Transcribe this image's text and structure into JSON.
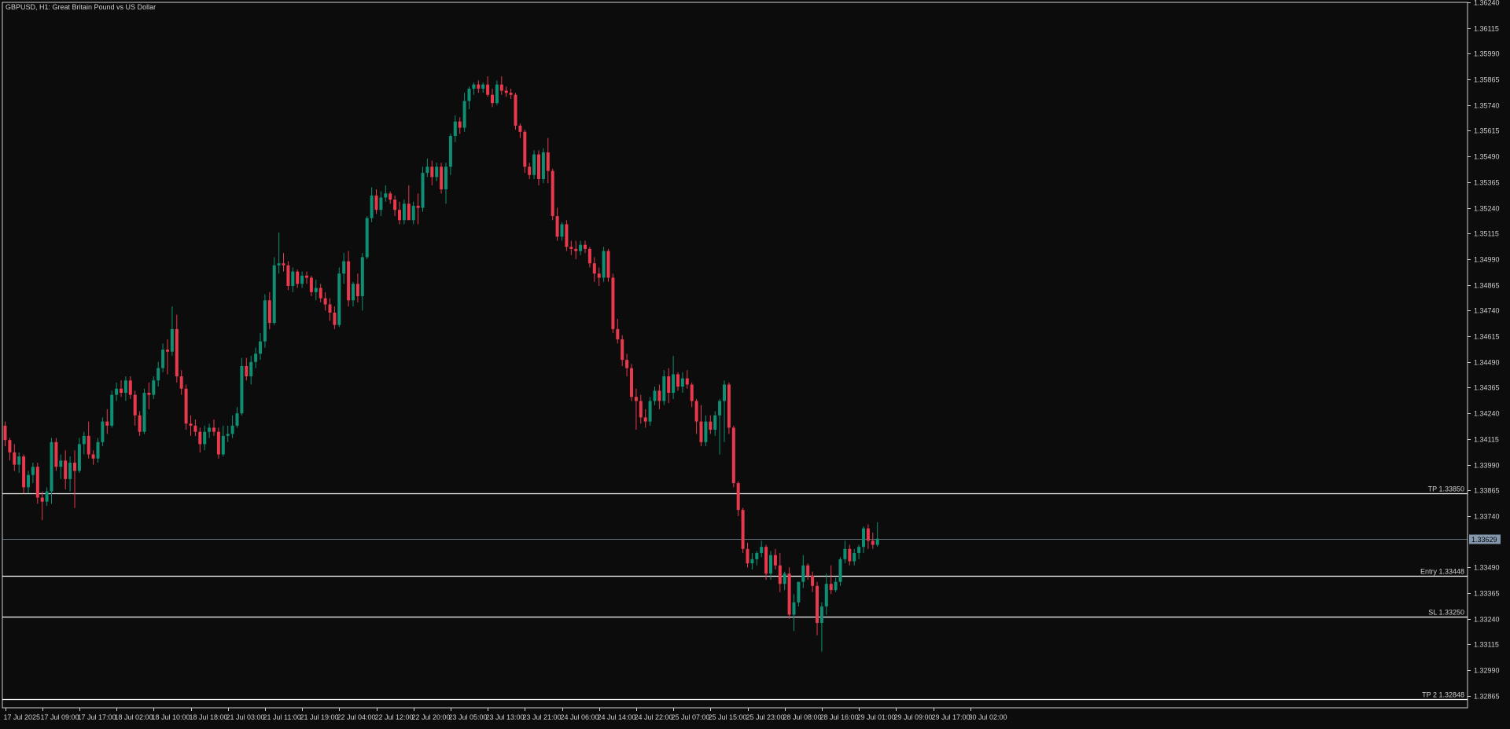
{
  "header": {
    "title": "GBPUSD, H1:  Great Britain Pound vs US Dollar"
  },
  "colors": {
    "background": "#0c0c0c",
    "frame": "#d0d0d0",
    "text": "#d0d0d0",
    "bull": "#0e8f73",
    "bear": "#e8394d",
    "level_line": "#ffffff",
    "bid_line": "#8497ad",
    "bid_tag_bg": "#8497ad",
    "bid_tag_text": "#0c0c0c"
  },
  "chart_data": {
    "type": "candlestick",
    "symbol": "GBPUSD",
    "timeframe": "H1",
    "title": "Great Britain Pound vs US Dollar",
    "ylim": [
      1.32807,
      1.3624
    ],
    "y_ticks": [
      "1.36240",
      "1.36115",
      "1.35990",
      "1.35865",
      "1.35740",
      "1.35615",
      "1.35490",
      "1.35365",
      "1.35240",
      "1.35115",
      "1.34990",
      "1.34865",
      "1.34740",
      "1.34615",
      "1.34490",
      "1.34365",
      "1.34240",
      "1.34115",
      "1.33990",
      "1.33865",
      "1.33740",
      "1.33490",
      "1.33365",
      "1.33240",
      "1.33115",
      "1.32990",
      "1.32865"
    ],
    "x_ticks": [
      {
        "label": "17 Jul 2025",
        "bar": 0
      },
      {
        "label": "17 Jul 09:00",
        "bar": 8
      },
      {
        "label": "17 Jul 17:00",
        "bar": 16
      },
      {
        "label": "18 Jul 02:00",
        "bar": 24
      },
      {
        "label": "18 Jul 10:00",
        "bar": 32
      },
      {
        "label": "18 Jul 18:00",
        "bar": 40
      },
      {
        "label": "21 Jul 03:00",
        "bar": 48
      },
      {
        "label": "21 Jul 11:00",
        "bar": 56
      },
      {
        "label": "21 Jul 19:00",
        "bar": 64
      },
      {
        "label": "22 Jul 04:00",
        "bar": 72
      },
      {
        "label": "22 Jul 12:00",
        "bar": 80
      },
      {
        "label": "22 Jul 20:00",
        "bar": 88
      },
      {
        "label": "23 Jul 05:00",
        "bar": 96
      },
      {
        "label": "23 Jul 13:00",
        "bar": 104
      },
      {
        "label": "23 Jul 21:00",
        "bar": 112
      },
      {
        "label": "24 Jul 06:00",
        "bar": 120
      },
      {
        "label": "24 Jul 14:00",
        "bar": 128
      },
      {
        "label": "24 Jul 22:00",
        "bar": 136
      },
      {
        "label": "25 Jul 07:00",
        "bar": 144
      },
      {
        "label": "25 Jul 15:00",
        "bar": 152
      },
      {
        "label": "25 Jul 23:00",
        "bar": 160
      },
      {
        "label": "28 Jul 08:00",
        "bar": 168
      },
      {
        "label": "28 Jul 16:00",
        "bar": 176
      },
      {
        "label": "29 Jul 01:00",
        "bar": 184
      },
      {
        "label": "29 Jul 09:00",
        "bar": 192
      },
      {
        "label": "29 Jul 17:00",
        "bar": 200
      },
      {
        "label": "30 Jul 02:00",
        "bar": 208
      }
    ],
    "levels": [
      {
        "label": "TP 1.33850",
        "value": 1.3385
      },
      {
        "label": "Entry 1.33448",
        "value": 1.33448
      },
      {
        "label": "SL 1.33250",
        "value": 1.3325
      },
      {
        "label": "TP 2 1.32848",
        "value": 1.32848
      }
    ],
    "current_price": {
      "label": "1.33629",
      "value": 1.33629
    },
    "ohlc": [
      [
        1.3418,
        1.342,
        1.3408,
        1.3411
      ],
      [
        1.3411,
        1.3412,
        1.3401,
        1.3405
      ],
      [
        1.3405,
        1.3409,
        1.3396,
        1.3399
      ],
      [
        1.3399,
        1.3405,
        1.3395,
        1.3403
      ],
      [
        1.3403,
        1.3404,
        1.3385,
        1.3388
      ],
      [
        1.3388,
        1.3396,
        1.3385,
        1.3394
      ],
      [
        1.3394,
        1.34,
        1.339,
        1.3398
      ],
      [
        1.3398,
        1.34,
        1.338,
        1.3383
      ],
      [
        1.3383,
        1.3386,
        1.3372,
        1.3381
      ],
      [
        1.3381,
        1.3388,
        1.3379,
        1.3386
      ],
      [
        1.3386,
        1.3412,
        1.338,
        1.341
      ],
      [
        1.341,
        1.3412,
        1.3396,
        1.3398
      ],
      [
        1.3398,
        1.3404,
        1.3392,
        1.3401
      ],
      [
        1.3401,
        1.3406,
        1.3387,
        1.3392
      ],
      [
        1.3392,
        1.3403,
        1.3386,
        1.34
      ],
      [
        1.34,
        1.3406,
        1.3378,
        1.3396
      ],
      [
        1.3396,
        1.3412,
        1.3395,
        1.3409
      ],
      [
        1.3409,
        1.3415,
        1.3404,
        1.3413
      ],
      [
        1.3413,
        1.342,
        1.3402,
        1.3404
      ],
      [
        1.3404,
        1.3406,
        1.3399,
        1.3402
      ],
      [
        1.3402,
        1.3412,
        1.34,
        1.341
      ],
      [
        1.341,
        1.3422,
        1.3408,
        1.342
      ],
      [
        1.342,
        1.3426,
        1.3414,
        1.3418
      ],
      [
        1.3418,
        1.3435,
        1.3417,
        1.3433
      ],
      [
        1.3433,
        1.3439,
        1.343,
        1.3436
      ],
      [
        1.3436,
        1.344,
        1.3432,
        1.3434
      ],
      [
        1.3434,
        1.3442,
        1.343,
        1.344
      ],
      [
        1.344,
        1.3442,
        1.3431,
        1.3433
      ],
      [
        1.3433,
        1.3435,
        1.3418,
        1.3423
      ],
      [
        1.3423,
        1.3425,
        1.3413,
        1.3415
      ],
      [
        1.3415,
        1.3436,
        1.3414,
        1.3434
      ],
      [
        1.3434,
        1.3439,
        1.3426,
        1.3433
      ],
      [
        1.3433,
        1.3442,
        1.3431,
        1.344
      ],
      [
        1.344,
        1.3449,
        1.3437,
        1.3446
      ],
      [
        1.3446,
        1.3458,
        1.3444,
        1.3455
      ],
      [
        1.3455,
        1.346,
        1.3443,
        1.3454
      ],
      [
        1.3454,
        1.3476,
        1.3452,
        1.3465
      ],
      [
        1.3465,
        1.3472,
        1.3439,
        1.3442
      ],
      [
        1.3442,
        1.3445,
        1.3433,
        1.3436
      ],
      [
        1.3436,
        1.3438,
        1.3416,
        1.3419
      ],
      [
        1.3419,
        1.3423,
        1.3413,
        1.3418
      ],
      [
        1.3418,
        1.3421,
        1.3413,
        1.3415
      ],
      [
        1.3415,
        1.3417,
        1.3405,
        1.3409
      ],
      [
        1.3409,
        1.3418,
        1.3406,
        1.3415
      ],
      [
        1.3415,
        1.3419,
        1.3412,
        1.3417
      ],
      [
        1.3417,
        1.3421,
        1.3413,
        1.3415
      ],
      [
        1.3415,
        1.3417,
        1.3402,
        1.3404
      ],
      [
        1.3404,
        1.3418,
        1.3403,
        1.3413
      ],
      [
        1.3413,
        1.3418,
        1.341,
        1.3414
      ],
      [
        1.3414,
        1.3423,
        1.3412,
        1.3418
      ],
      [
        1.3418,
        1.3427,
        1.3417,
        1.3424
      ],
      [
        1.3424,
        1.3451,
        1.3423,
        1.3447
      ],
      [
        1.3447,
        1.3451,
        1.344,
        1.3442
      ],
      [
        1.3442,
        1.3452,
        1.3438,
        1.3449
      ],
      [
        1.3449,
        1.3456,
        1.3446,
        1.3453
      ],
      [
        1.3453,
        1.3463,
        1.345,
        1.3459
      ],
      [
        1.3459,
        1.3482,
        1.3456,
        1.3479
      ],
      [
        1.3479,
        1.3483,
        1.3465,
        1.3468
      ],
      [
        1.3468,
        1.35,
        1.3467,
        1.3496
      ],
      [
        1.3496,
        1.3512,
        1.3492,
        1.3497
      ],
      [
        1.3497,
        1.3502,
        1.3493,
        1.3496
      ],
      [
        1.3496,
        1.3498,
        1.3484,
        1.3486
      ],
      [
        1.3486,
        1.3495,
        1.3483,
        1.3493
      ],
      [
        1.3493,
        1.3494,
        1.3485,
        1.3487
      ],
      [
        1.3487,
        1.3493,
        1.3485,
        1.3491
      ],
      [
        1.3491,
        1.3493,
        1.3487,
        1.349
      ],
      [
        1.349,
        1.3491,
        1.3481,
        1.3483
      ],
      [
        1.3483,
        1.3489,
        1.3479,
        1.3485
      ],
      [
        1.3485,
        1.3487,
        1.3478,
        1.348
      ],
      [
        1.348,
        1.3483,
        1.3474,
        1.3477
      ],
      [
        1.3477,
        1.348,
        1.3469,
        1.3473
      ],
      [
        1.3473,
        1.3476,
        1.3465,
        1.3467
      ],
      [
        1.3467,
        1.3495,
        1.3466,
        1.3492
      ],
      [
        1.3492,
        1.3502,
        1.3487,
        1.3498
      ],
      [
        1.3498,
        1.3503,
        1.3476,
        1.3479
      ],
      [
        1.3479,
        1.3488,
        1.3476,
        1.3487
      ],
      [
        1.3487,
        1.3492,
        1.3478,
        1.3481
      ],
      [
        1.3481,
        1.3502,
        1.3474,
        1.35
      ],
      [
        1.35,
        1.352,
        1.3499,
        1.3519
      ],
      [
        1.3519,
        1.3534,
        1.3517,
        1.353
      ],
      [
        1.353,
        1.3533,
        1.3521,
        1.3523
      ],
      [
        1.3523,
        1.3532,
        1.352,
        1.3529
      ],
      [
        1.3529,
        1.3535,
        1.3527,
        1.3531
      ],
      [
        1.3531,
        1.3532,
        1.3526,
        1.3528
      ],
      [
        1.3528,
        1.353,
        1.352,
        1.3523
      ],
      [
        1.3523,
        1.3527,
        1.3516,
        1.3518
      ],
      [
        1.3518,
        1.3528,
        1.3516,
        1.3526
      ],
      [
        1.3526,
        1.3535,
        1.3522,
        1.3518
      ],
      [
        1.3518,
        1.3527,
        1.3516,
        1.3525
      ],
      [
        1.3525,
        1.3531,
        1.3516,
        1.3524
      ],
      [
        1.3524,
        1.3544,
        1.3522,
        1.3541
      ],
      [
        1.3541,
        1.3548,
        1.3539,
        1.3544
      ],
      [
        1.3544,
        1.3547,
        1.3535,
        1.3539
      ],
      [
        1.3539,
        1.3546,
        1.3537,
        1.3544
      ],
      [
        1.3544,
        1.3546,
        1.3531,
        1.3533
      ],
      [
        1.3533,
        1.3546,
        1.3526,
        1.3544
      ],
      [
        1.3544,
        1.356,
        1.354,
        1.3559
      ],
      [
        1.3559,
        1.3569,
        1.3556,
        1.3566
      ],
      [
        1.3566,
        1.3568,
        1.356,
        1.3563
      ],
      [
        1.3563,
        1.358,
        1.3561,
        1.3576
      ],
      [
        1.3576,
        1.3583,
        1.3572,
        1.3582
      ],
      [
        1.3582,
        1.3585,
        1.3579,
        1.3584
      ],
      [
        1.3584,
        1.3586,
        1.358,
        1.3582
      ],
      [
        1.3582,
        1.3585,
        1.358,
        1.3584
      ],
      [
        1.3584,
        1.3588,
        1.3578,
        1.3579
      ],
      [
        1.3579,
        1.3582,
        1.3573,
        1.3575
      ],
      [
        1.3575,
        1.3586,
        1.3574,
        1.3584
      ],
      [
        1.3584,
        1.3588,
        1.3579,
        1.3581
      ],
      [
        1.3581,
        1.3583,
        1.3578,
        1.358
      ],
      [
        1.358,
        1.3582,
        1.3577,
        1.3579
      ],
      [
        1.3579,
        1.358,
        1.3562,
        1.3564
      ],
      [
        1.3564,
        1.3565,
        1.3558,
        1.3561
      ],
      [
        1.3561,
        1.3562,
        1.3541,
        1.3544
      ],
      [
        1.3544,
        1.3546,
        1.3538,
        1.354
      ],
      [
        1.354,
        1.3552,
        1.3538,
        1.355
      ],
      [
        1.355,
        1.3552,
        1.3535,
        1.3538
      ],
      [
        1.3538,
        1.3553,
        1.3536,
        1.3551
      ],
      [
        1.3551,
        1.3558,
        1.3536,
        1.3542
      ],
      [
        1.3542,
        1.3543,
        1.3518,
        1.352
      ],
      [
        1.352,
        1.3524,
        1.3508,
        1.351
      ],
      [
        1.351,
        1.3517,
        1.3508,
        1.3516
      ],
      [
        1.3516,
        1.3518,
        1.3503,
        1.3505
      ],
      [
        1.3505,
        1.3508,
        1.3501,
        1.3504
      ],
      [
        1.3504,
        1.3508,
        1.3499,
        1.3503
      ],
      [
        1.3503,
        1.3508,
        1.3501,
        1.3506
      ],
      [
        1.3506,
        1.3508,
        1.3502,
        1.3504
      ],
      [
        1.3504,
        1.3505,
        1.3495,
        1.3497
      ],
      [
        1.3497,
        1.35,
        1.3488,
        1.3492
      ],
      [
        1.3492,
        1.3495,
        1.3486,
        1.349
      ],
      [
        1.349,
        1.3505,
        1.3488,
        1.3503
      ],
      [
        1.3503,
        1.3504,
        1.3488,
        1.349
      ],
      [
        1.349,
        1.3492,
        1.3463,
        1.3465
      ],
      [
        1.3465,
        1.347,
        1.3458,
        1.346
      ],
      [
        1.346,
        1.3462,
        1.3447,
        1.345
      ],
      [
        1.345,
        1.3453,
        1.3442,
        1.3446
      ],
      [
        1.3446,
        1.3448,
        1.343,
        1.3432
      ],
      [
        1.3432,
        1.3436,
        1.3416,
        1.343
      ],
      [
        1.343,
        1.3433,
        1.3419,
        1.3422
      ],
      [
        1.3422,
        1.3426,
        1.3417,
        1.342
      ],
      [
        1.342,
        1.3432,
        1.3418,
        1.343
      ],
      [
        1.343,
        1.3437,
        1.3428,
        1.3435
      ],
      [
        1.3435,
        1.3438,
        1.3426,
        1.343
      ],
      [
        1.343,
        1.3445,
        1.3428,
        1.3442
      ],
      [
        1.3442,
        1.3446,
        1.3429,
        1.3434
      ],
      [
        1.3434,
        1.3452,
        1.3431,
        1.3443
      ],
      [
        1.3443,
        1.3444,
        1.3435,
        1.3437
      ],
      [
        1.3437,
        1.3444,
        1.3434,
        1.3441
      ],
      [
        1.3441,
        1.3445,
        1.3436,
        1.3438
      ],
      [
        1.3438,
        1.3439,
        1.3427,
        1.343
      ],
      [
        1.343,
        1.3431,
        1.3414,
        1.342
      ],
      [
        1.342,
        1.3428,
        1.3408,
        1.341
      ],
      [
        1.341,
        1.3423,
        1.3408,
        1.342
      ],
      [
        1.342,
        1.3423,
        1.3414,
        1.3416
      ],
      [
        1.3416,
        1.3425,
        1.3413,
        1.3423
      ],
      [
        1.3423,
        1.3431,
        1.3404,
        1.343
      ],
      [
        1.343,
        1.344,
        1.341,
        1.3438
      ],
      [
        1.3438,
        1.3439,
        1.3414,
        1.3417
      ],
      [
        1.3417,
        1.3418,
        1.3388,
        1.339
      ],
      [
        1.339,
        1.3391,
        1.3374,
        1.3377
      ],
      [
        1.3377,
        1.3378,
        1.3356,
        1.3358
      ],
      [
        1.3358,
        1.3361,
        1.3349,
        1.3351
      ],
      [
        1.3351,
        1.3356,
        1.3348,
        1.3353
      ],
      [
        1.3353,
        1.3357,
        1.335,
        1.3356
      ],
      [
        1.3356,
        1.3362,
        1.3354,
        1.3359
      ],
      [
        1.3359,
        1.336,
        1.3343,
        1.3346
      ],
      [
        1.3346,
        1.3357,
        1.3343,
        1.3355
      ],
      [
        1.3355,
        1.3358,
        1.3348,
        1.335
      ],
      [
        1.335,
        1.3356,
        1.3337,
        1.3341
      ],
      [
        1.3341,
        1.3347,
        1.3338,
        1.3346
      ],
      [
        1.3346,
        1.3349,
        1.3324,
        1.3326
      ],
      [
        1.3326,
        1.3336,
        1.3318,
        1.3332
      ],
      [
        1.3332,
        1.3342,
        1.333,
        1.3342
      ],
      [
        1.3342,
        1.3355,
        1.3339,
        1.335
      ],
      [
        1.335,
        1.3351,
        1.3343,
        1.3345
      ],
      [
        1.3345,
        1.3347,
        1.3337,
        1.334
      ],
      [
        1.334,
        1.3342,
        1.3316,
        1.3322
      ],
      [
        1.3322,
        1.3332,
        1.3308,
        1.333
      ],
      [
        1.333,
        1.3346,
        1.3326,
        1.3341
      ],
      [
        1.3341,
        1.335,
        1.3336,
        1.3338
      ],
      [
        1.3338,
        1.3344,
        1.3337,
        1.3342
      ],
      [
        1.3342,
        1.3354,
        1.334,
        1.3353
      ],
      [
        1.3353,
        1.3362,
        1.3351,
        1.3358
      ],
      [
        1.3358,
        1.336,
        1.335,
        1.3352
      ],
      [
        1.3352,
        1.3358,
        1.335,
        1.3356
      ],
      [
        1.3356,
        1.336,
        1.3353,
        1.3359
      ],
      [
        1.3359,
        1.3369,
        1.3356,
        1.3368
      ],
      [
        1.3368,
        1.337,
        1.3358,
        1.3362
      ],
      [
        1.3362,
        1.3366,
        1.3358,
        1.336
      ],
      [
        1.336,
        1.3371,
        1.3359,
        1.3363
      ]
    ]
  }
}
